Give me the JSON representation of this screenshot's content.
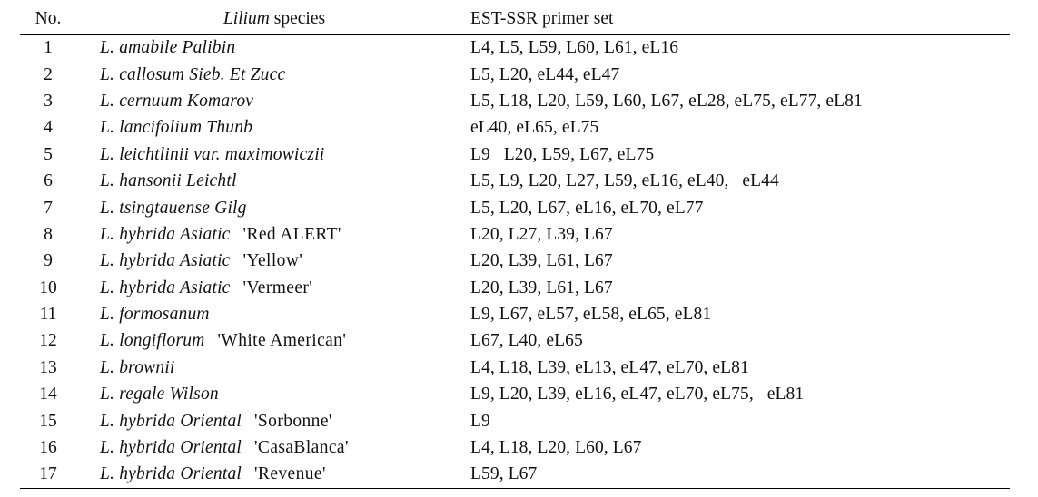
{
  "table": {
    "headers": {
      "no": "No.",
      "species_italic": "Lilium",
      "species_roman": " species",
      "primer": "EST-SSR primer set"
    },
    "rows": [
      {
        "no": "1",
        "species": "L. amabile Palibin",
        "cultivar": "",
        "primer": "L4, L5, L59, L60, L61, eL16"
      },
      {
        "no": "2",
        "species": "L. callosum Sieb. Et Zucc",
        "cultivar": "",
        "primer": "L5, L20, eL44, eL47"
      },
      {
        "no": "3",
        "species": "L. cernuum Komarov",
        "cultivar": "",
        "primer": "L5, L18, L20, L59, L60, L67, eL28, eL75, eL77, eL81"
      },
      {
        "no": "4",
        "species": "L. lancifolium Thunb",
        "cultivar": "",
        "primer": "eL40, eL65, eL75"
      },
      {
        "no": "5",
        "species": "L. leichtlinii var. maximowiczii",
        "cultivar": "",
        "primer": "L9   L20, L59, L67, eL75"
      },
      {
        "no": "6",
        "species": "L. hansonii Leichtl",
        "cultivar": "",
        "primer": "L5, L9, L20, L27, L59, eL16, eL40,   eL44"
      },
      {
        "no": "7",
        "species": "L. tsingtauense Gilg",
        "cultivar": "",
        "primer": "L5, L20, L67, eL16, eL70, eL77"
      },
      {
        "no": "8",
        "species": "L. hybrida Asiatic",
        "cultivar": "'Red ALERT'",
        "primer": "L20, L27, L39, L67"
      },
      {
        "no": "9",
        "species": "L. hybrida Asiatic",
        "cultivar": "'Yellow'",
        "primer": "L20, L39, L61, L67"
      },
      {
        "no": "10",
        "species": "L. hybrida Asiatic",
        "cultivar": "'Vermeer'",
        "primer": "L20, L39, L61, L67"
      },
      {
        "no": "11",
        "species": "L. formosanum",
        "cultivar": "",
        "primer": "L9, L67, eL57, eL58, eL65, eL81"
      },
      {
        "no": "12",
        "species": "L. longiflorum",
        "cultivar": "'White American'",
        "primer": "L67, L40, eL65"
      },
      {
        "no": "13",
        "species": "L. brownii",
        "cultivar": "",
        "primer": "L4, L18, L39, eL13, eL47, eL70, eL81"
      },
      {
        "no": "14",
        "species": "L. regale Wilson",
        "cultivar": "",
        "primer": "L9, L20, L39, eL16, eL47, eL70, eL75,   eL81"
      },
      {
        "no": "15",
        "species": "L. hybrida Oriental",
        "cultivar": "'Sorbonne'",
        "primer": "L9"
      },
      {
        "no": "16",
        "species": "L. hybrida Oriental",
        "cultivar": "'CasaBlanca'",
        "primer": "L4, L18, L20, L60, L67"
      },
      {
        "no": "17",
        "species": "L. hybrida Oriental",
        "cultivar": "'Revenue'",
        "primer": "L59, L67"
      }
    ]
  },
  "colors": {
    "rule": "#000000",
    "text": "#111111",
    "background": "#ffffff"
  }
}
